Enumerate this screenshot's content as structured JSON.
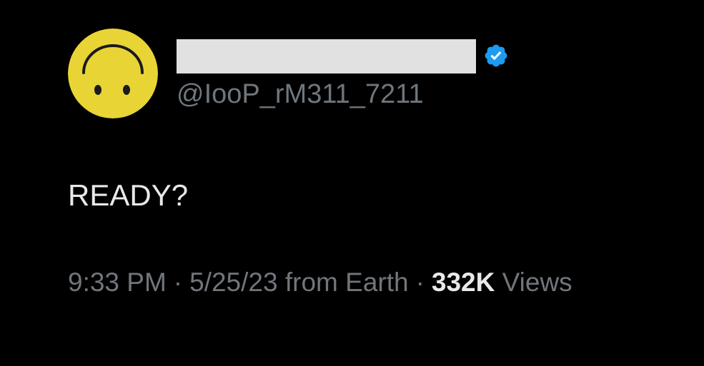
{
  "tweet": {
    "author": {
      "display_name": "",
      "handle": "@IooP_rM311_7211",
      "avatar": "upside-down-smiley",
      "verified_icon": "verified-badge-icon"
    },
    "text": "READY?",
    "meta": {
      "time": "9:33 PM",
      "separator": "·",
      "date": "5/25/23",
      "source": "from Earth",
      "views_count": "332K",
      "views_label": "Views"
    }
  },
  "colors": {
    "background": "#000000",
    "primary_text": "#e7e9ea",
    "secondary_text": "#71767b",
    "verified_blue": "#1d9bf0",
    "avatar_yellow": "#e9d436",
    "redaction_box": "#e1e1e1"
  }
}
